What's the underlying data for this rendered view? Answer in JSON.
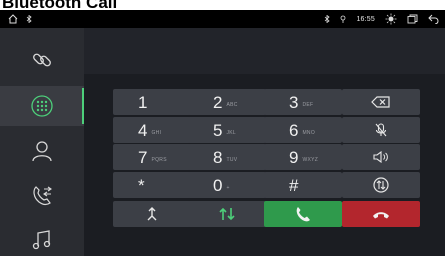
{
  "title": "Bluetooth Call",
  "status": {
    "time": "16:55"
  },
  "keypad": [
    {
      "digit": "1",
      "letters": ""
    },
    {
      "digit": "2",
      "letters": "ABC"
    },
    {
      "digit": "3",
      "letters": "DEF"
    },
    {
      "digit": "4",
      "letters": "GHI"
    },
    {
      "digit": "5",
      "letters": "JKL"
    },
    {
      "digit": "6",
      "letters": "MNO"
    },
    {
      "digit": "7",
      "letters": "PQRS"
    },
    {
      "digit": "8",
      "letters": "TUV"
    },
    {
      "digit": "9",
      "letters": "WXYZ"
    },
    {
      "digit": "*",
      "letters": ""
    },
    {
      "digit": "0",
      "letters": "+"
    },
    {
      "digit": "#",
      "letters": ""
    }
  ],
  "icons": {
    "home": "home-icon",
    "bluetooth": "bluetooth-icon",
    "link": "link-icon",
    "dialpad": "dialpad-icon",
    "contacts": "contacts-icon",
    "recents": "recent-calls-icon",
    "music": "music-icon",
    "backspace": "backspace-icon",
    "mute": "mic-mute-icon",
    "speaker": "speaker-icon",
    "switch": "call-switch-icon",
    "hold": "hold-icon",
    "transfer": "transfer-icon",
    "call": "call-icon",
    "hangup": "hang-up-icon"
  },
  "colors": {
    "accent": "#4dcf7a",
    "call": "#2f9a4c",
    "hangup": "#b3262d"
  }
}
